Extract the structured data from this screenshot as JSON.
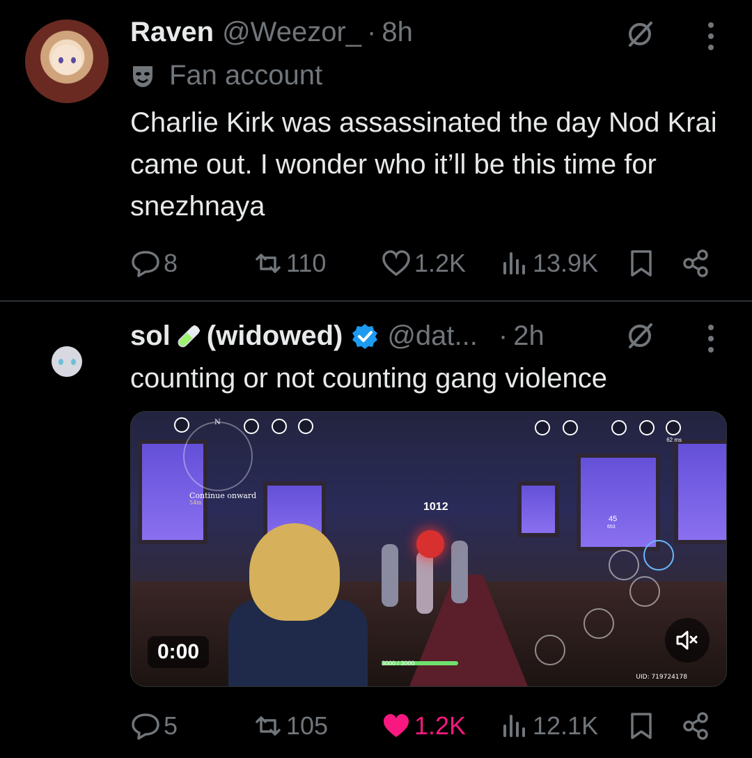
{
  "tweets": [
    {
      "name": "Raven",
      "handle": "@Weezor_",
      "separator": "·",
      "time": "8h",
      "label": "Fan account",
      "text": "Charlie Kirk was assassinated the day Nod Krai came out. I wonder who it’ll be this time for snezhnaya",
      "replies": "8",
      "reposts": "110",
      "likes": "1.2K",
      "views": "13.9K",
      "liked": false
    },
    {
      "name": "sol",
      "name_suffix": "(widowed)",
      "emoji": "test-tube-icon",
      "handle": "@dat...",
      "separator": "·",
      "time": "2h",
      "text": "counting or not counting gang violence",
      "replies": "5",
      "reposts": "105",
      "likes": "1.2K",
      "views": "12.1K",
      "liked": true,
      "video": {
        "timer": "0:00",
        "quest_label": "Continue onward",
        "quest_distance": "54m",
        "damage_number": "1012",
        "ammo": "45",
        "ammo_sub": "653",
        "ping": "62 ms",
        "hp_text": "3000 / 3000",
        "uid": "UID: 719724178",
        "compass": "N"
      }
    }
  ],
  "colors": {
    "background": "#000000",
    "text": "#e7e9ea",
    "muted": "#71767b",
    "like_active": "#f91880",
    "verified": "#1d9bf0",
    "divider": "#2f3336"
  }
}
